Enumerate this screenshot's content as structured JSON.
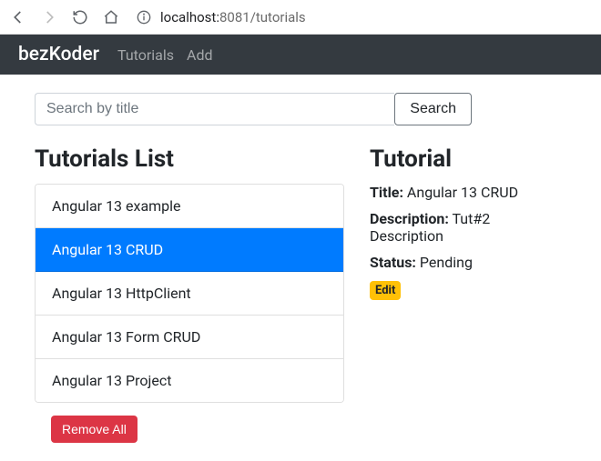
{
  "browser": {
    "url_host": "localhost:",
    "url_port_path": "8081/tutorials"
  },
  "navbar": {
    "brand": "bezKoder",
    "links": [
      "Tutorials",
      "Add"
    ]
  },
  "search": {
    "placeholder": "Search by title",
    "button": "Search"
  },
  "list": {
    "heading": "Tutorials List",
    "items": [
      "Angular 13 example",
      "Angular 13 CRUD",
      "Angular 13 HttpClient",
      "Angular 13 Form CRUD",
      "Angular 13 Project"
    ],
    "active_index": 1,
    "remove_all": "Remove All"
  },
  "detail": {
    "heading": "Tutorial",
    "title_label": "Title:",
    "title_value": "Angular 13 CRUD",
    "desc_label": "Description:",
    "desc_value": "Tut#2 Description",
    "status_label": "Status:",
    "status_value": "Pending",
    "edit": "Edit"
  }
}
